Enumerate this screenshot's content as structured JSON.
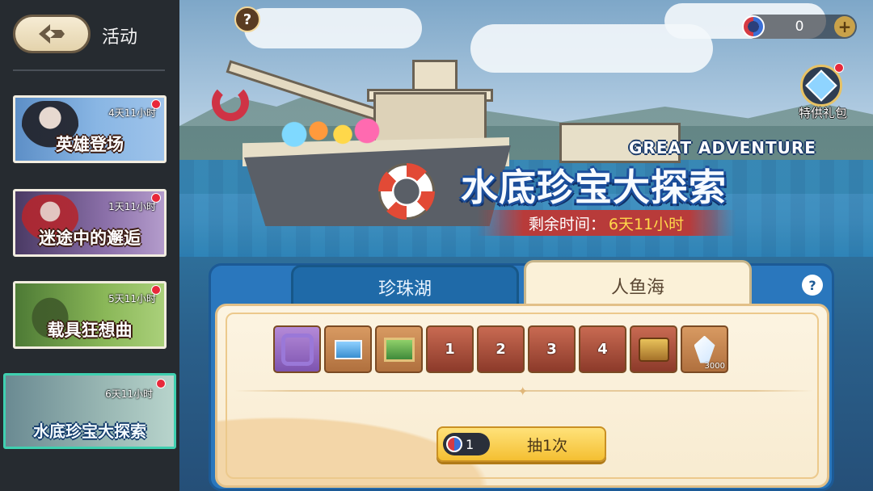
{
  "sidebar": {
    "title": "活动",
    "events": [
      {
        "name": "英雄登场",
        "time": "4天11小时"
      },
      {
        "name": "迷途中的邂逅",
        "time": "1天11小时"
      },
      {
        "name": "载具狂想曲",
        "time": "5天11小时"
      },
      {
        "name": "水底珍宝大探索",
        "time": "6天11小时"
      }
    ]
  },
  "banner": {
    "subtitle": "GREAT ADVENTURE",
    "title": "水底珍宝大探索",
    "remaining_label": "剩余时间：",
    "remaining_value": "6天11小时"
  },
  "topbar": {
    "help": "?",
    "currency_value": "0",
    "plus": "+",
    "gift_label": "特供礼包"
  },
  "tabs": [
    {
      "label": "珍珠湖",
      "active": false
    },
    {
      "label": "人鱼海",
      "active": true
    }
  ],
  "panel_help": "?",
  "rewards": [
    {
      "icon": "octopus-frame-icon",
      "frame": "purple"
    },
    {
      "icon": "scene-card-icon",
      "frame": "brown"
    },
    {
      "icon": "landscape-picture-icon",
      "frame": "brown"
    },
    {
      "icon": "octopus-ticket-icon",
      "label": "1",
      "frame": "red"
    },
    {
      "icon": "octopus-ticket-icon",
      "label": "2",
      "frame": "red"
    },
    {
      "icon": "octopus-ticket-icon",
      "label": "3",
      "frame": "red"
    },
    {
      "icon": "octopus-ticket-icon",
      "label": "4",
      "frame": "red"
    },
    {
      "icon": "treasure-chest-icon",
      "frame": "red"
    },
    {
      "icon": "crystal-icon",
      "frame": "brown",
      "qty": "3000"
    }
  ],
  "draw": {
    "cost": "1",
    "label": "抽1次"
  },
  "colors": {
    "panel_blue": "#2a77bd",
    "cream": "#fcf4e2",
    "draw_yellow": "#f4bf32",
    "notify_red": "#e8283a",
    "active_card_border": "#3fd0b0"
  }
}
